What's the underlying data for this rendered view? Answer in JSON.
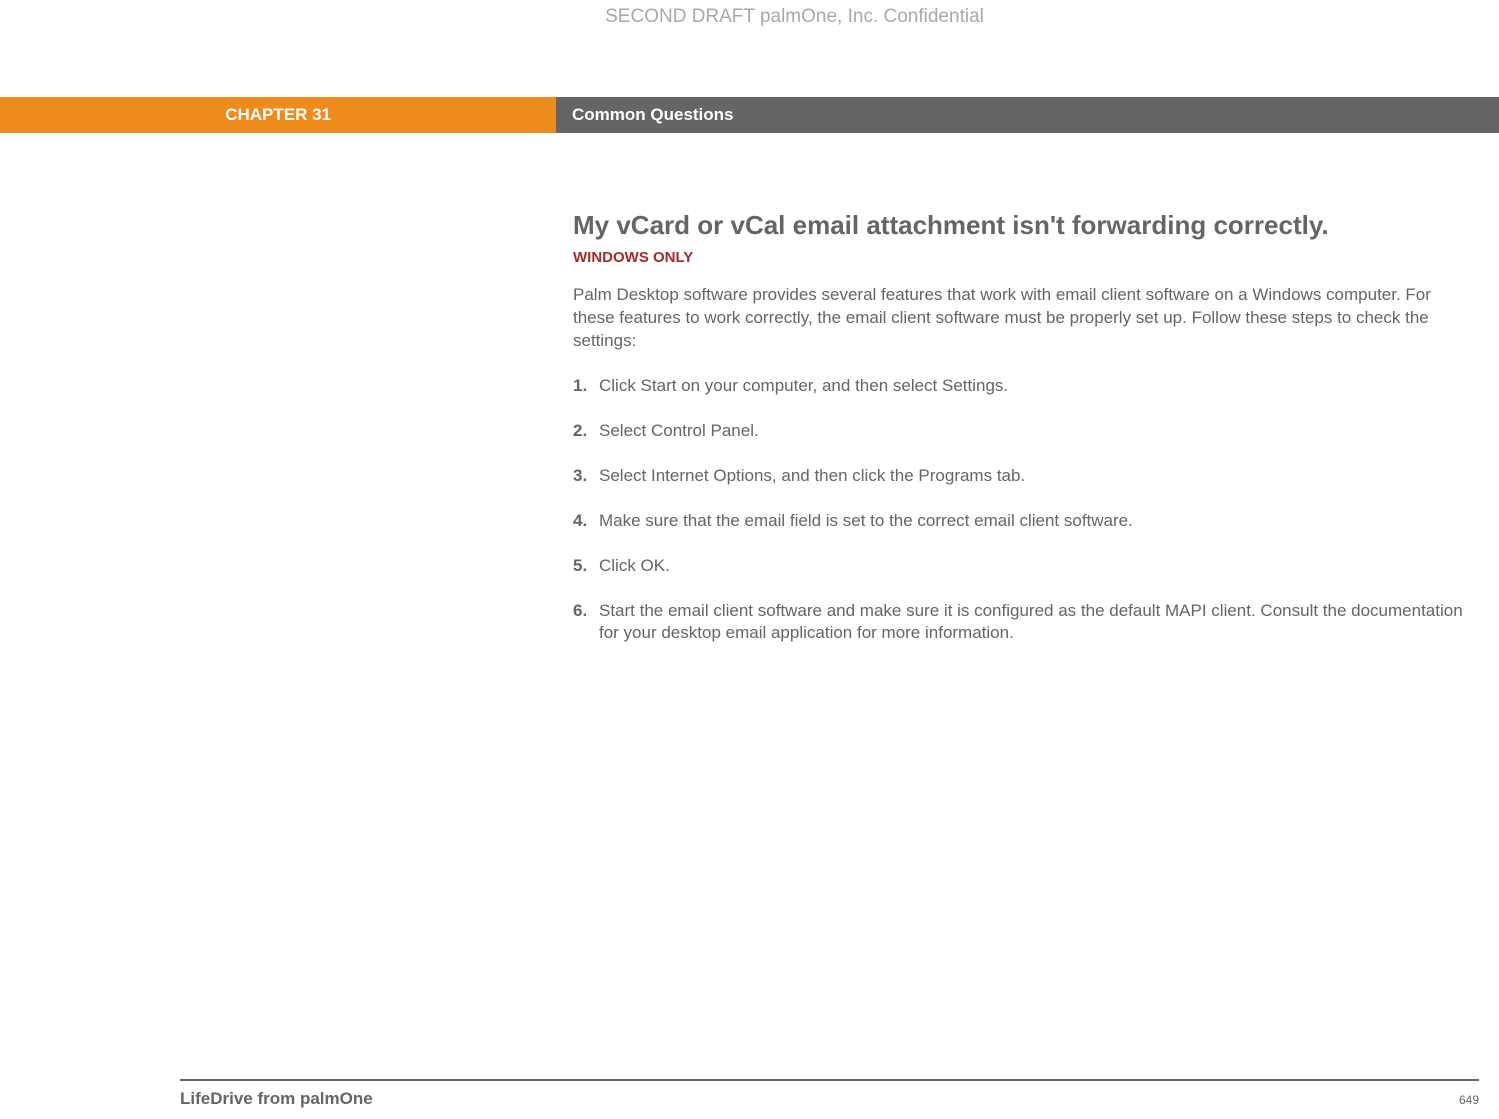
{
  "confidential": "SECOND DRAFT palmOne, Inc.  Confidential",
  "header": {
    "chapter": "CHAPTER 31",
    "title": "Common Questions"
  },
  "content": {
    "heading": "My vCard or vCal email attachment isn't forwarding correctly.",
    "platform_note": "WINDOWS ONLY",
    "intro": "Palm Desktop software provides several features that work with email client software on a Windows computer. For these features to work correctly, the email client software must be properly set up. Follow these steps to check the settings:",
    "steps": [
      {
        "num": "1.",
        "text": "Click Start on your computer, and then select Settings."
      },
      {
        "num": "2.",
        "text": "Select Control Panel."
      },
      {
        "num": "3.",
        "text": "Select Internet Options, and then click the Programs tab."
      },
      {
        "num": "4.",
        "text": "Make sure that the email field is set to the correct email client software."
      },
      {
        "num": "5.",
        "text": "Click OK."
      },
      {
        "num": "6.",
        "text": "Start the email client software and make sure it is configured as the default MAPI client. Consult the documentation for your desktop email application for more information."
      }
    ]
  },
  "footer": {
    "title": "LifeDrive from palmOne",
    "page": "649"
  }
}
